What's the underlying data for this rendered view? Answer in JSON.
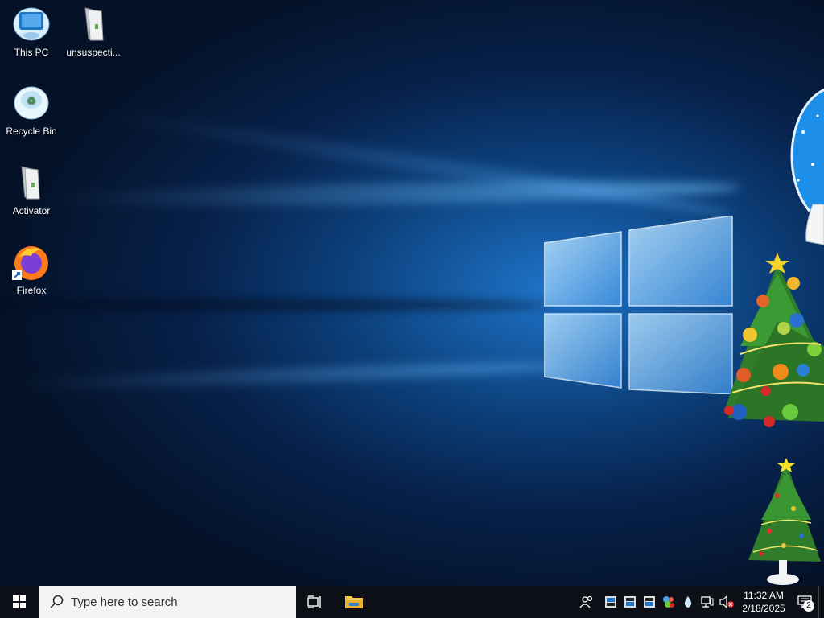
{
  "desktop": {
    "icons": [
      {
        "label": "This PC"
      },
      {
        "label": "unsuspecti..."
      },
      {
        "label": "Recycle Bin"
      },
      {
        "label": "Activator"
      },
      {
        "label": "Firefox"
      }
    ]
  },
  "taskbar": {
    "search_placeholder": "Type here to search",
    "clock": {
      "time": "11:32 AM",
      "date": "2/18/2025"
    },
    "notification_count": "2"
  }
}
